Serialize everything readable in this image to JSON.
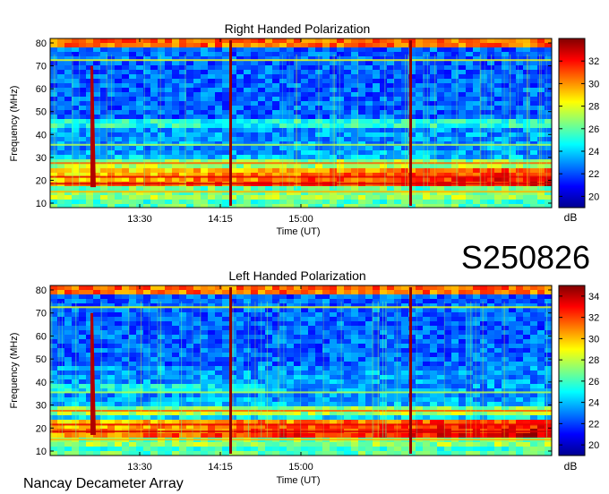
{
  "station_label": "Nancay Decameter Array",
  "event_id": "S250826",
  "colormap": {
    "stops": [
      "#00008f",
      "#0000ff",
      "#0080ff",
      "#00ffff",
      "#80ff80",
      "#ffff00",
      "#ff8000",
      "#ff0000",
      "#800000"
    ]
  },
  "chart_data": [
    {
      "type": "heatmap",
      "title": "Right Handed Polarization",
      "xlabel": "Time (UT)",
      "ylabel": "Frequency (MHz)",
      "x_ticks": [
        "13:30",
        "14:15",
        "15:00"
      ],
      "y_ticks": [
        "10",
        "20",
        "30",
        "40",
        "50",
        "60",
        "70",
        "80"
      ],
      "ylim": [
        10,
        80
      ],
      "colorbar": {
        "unit": "dB",
        "ticks": [
          "20",
          "22",
          "24",
          "26",
          "28",
          "30",
          "32"
        ],
        "range": [
          19,
          34
        ]
      }
    },
    {
      "type": "heatmap",
      "title": "Left Handed Polarization",
      "xlabel": "Time (UT)",
      "ylabel": "Frequency (MHz)",
      "x_ticks": [
        "13:30",
        "14:15",
        "15:00"
      ],
      "y_ticks": [
        "10",
        "20",
        "30",
        "40",
        "50",
        "60",
        "70",
        "80"
      ],
      "ylim": [
        10,
        80
      ],
      "colorbar": {
        "unit": "dB",
        "ticks": [
          "20",
          "22",
          "24",
          "26",
          "28",
          "30",
          "32",
          "34"
        ],
        "range": [
          19,
          35
        ]
      }
    }
  ]
}
